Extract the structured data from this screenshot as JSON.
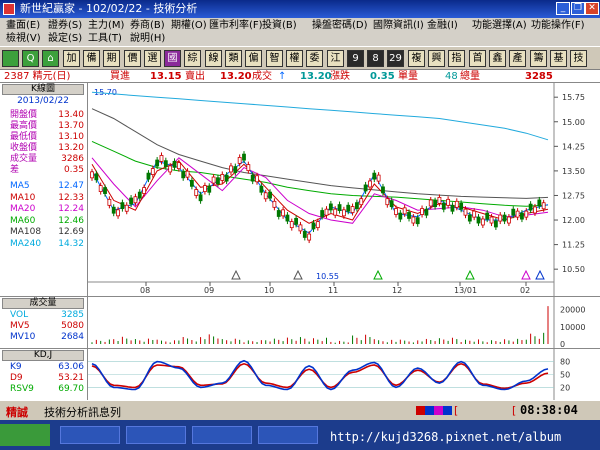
{
  "window": {
    "title": "新世紀贏家 - 102/02/22 - 技術分析",
    "minimize": "_",
    "restore": "❐",
    "close": "✕"
  },
  "menu": {
    "row1": [
      {
        "label": "畫面(E)"
      },
      {
        "label": "證券(S)"
      },
      {
        "label": "主力(M)"
      },
      {
        "label": "券商(B)"
      },
      {
        "label": "期權(O)"
      },
      {
        "label": "匯市利率(F)"
      },
      {
        "label": "投資(B)"
      },
      {
        "label": "操盤密碼(D)"
      },
      {
        "label": "國際資訊(I)"
      },
      {
        "label": "金融(I)"
      },
      {
        "label": "功能選擇(A)"
      },
      {
        "label": "功能操作(F)"
      }
    ],
    "row2": [
      {
        "label": "檢視(V)"
      },
      {
        "label": "設定(S)"
      },
      {
        "label": "工具(T)"
      },
      {
        "label": "說明(H)"
      }
    ]
  },
  "toolbar": {
    "buttons": [
      {
        "label": "Q",
        "icon": "search-icon",
        "style": "green"
      },
      {
        "label": "⌂",
        "icon": "home-icon",
        "style": "green"
      },
      {
        "label": "加",
        "style": "plain"
      },
      {
        "label": "備",
        "style": "plain"
      },
      {
        "label": "期",
        "style": "plain"
      },
      {
        "label": "價",
        "style": "plain"
      },
      {
        "label": "選",
        "style": "plain"
      },
      {
        "label": "國",
        "style": "purple"
      },
      {
        "label": "綜",
        "style": "plain"
      },
      {
        "label": "線",
        "style": "plain"
      },
      {
        "label": "類",
        "style": "plain"
      },
      {
        "label": "偏",
        "style": "plain"
      },
      {
        "label": "智",
        "style": "plain"
      },
      {
        "label": "權",
        "style": "plain"
      },
      {
        "label": "委",
        "style": "plain"
      },
      {
        "label": "江",
        "style": "plain"
      },
      {
        "label": "9",
        "style": "dark"
      },
      {
        "label": "8",
        "style": "dark"
      },
      {
        "label": "29",
        "style": "dark"
      },
      {
        "label": "複",
        "style": "plain"
      },
      {
        "label": "興",
        "style": "plain"
      },
      {
        "label": "指",
        "style": "plain"
      },
      {
        "label": "首",
        "style": "plain"
      },
      {
        "label": "鑫",
        "style": "plain"
      },
      {
        "label": "產",
        "style": "plain"
      },
      {
        "label": "籌",
        "style": "plain"
      },
      {
        "label": "基",
        "style": "plain"
      },
      {
        "label": "技",
        "style": "plain"
      }
    ]
  },
  "info": {
    "stock": "2387 精元(日)",
    "buy_label": "買進",
    "buy": "13.15",
    "sell_label": "賣出",
    "sell": "13.20",
    "trade_label": "成交",
    "trade": "13.20",
    "change_label": "漲跌",
    "change": "0.35",
    "vol_label": "單量",
    "total": "48",
    "total_label": "總量",
    "total_vol": "3285"
  },
  "quote": {
    "panel_title": "K線圖",
    "date": "2013/02/22",
    "rows": [
      {
        "label": "開盤價",
        "value": "13.40",
        "color": "#cc0000"
      },
      {
        "label": "最高價",
        "value": "13.70",
        "color": "#cc0000"
      },
      {
        "label": "最低價",
        "value": "13.10",
        "color": "#cc0000"
      },
      {
        "label": "收盤價",
        "value": "13.20",
        "color": "#cc0000"
      },
      {
        "label": "成交量",
        "value": "3286",
        "color": "#cc0000"
      },
      {
        "label": "差",
        "value": "0.35",
        "color": "#cc0000"
      }
    ],
    "ma": [
      {
        "label": "MA5",
        "value": "12.47",
        "color": "#0066ff"
      },
      {
        "label": "MA10",
        "value": "12.33",
        "color": "#cc0000"
      },
      {
        "label": "MA20",
        "value": "12.24",
        "color": "#cc00cc"
      },
      {
        "label": "MA60",
        "value": "12.46",
        "color": "#00aa00"
      },
      {
        "label": "MA108",
        "value": "12.69",
        "color": "#333333"
      },
      {
        "label": "MA240",
        "value": "14.32",
        "color": "#00aadd"
      }
    ]
  },
  "chart_data": {
    "type": "line",
    "title": "",
    "price_high_label": "15.70",
    "price_low_label": "10.55",
    "y_ticks": [
      "15.75",
      "15.00",
      "14.25",
      "13.50",
      "12.75",
      "12.00",
      "11.25",
      "10.50"
    ],
    "ylim": [
      10.2,
      16.0
    ],
    "x_ticks": [
      "08",
      "09",
      "10",
      "11",
      "12",
      "13/01",
      "02"
    ],
    "series": [
      {
        "name": "MA240",
        "color": "#22aadd",
        "values": [
          15.9,
          15.85,
          15.8,
          15.75,
          15.7,
          15.65,
          15.6,
          15.55,
          15.5,
          15.45,
          15.4,
          15.35,
          15.3,
          15.25,
          15.2,
          15.15,
          15.1,
          15.0,
          14.9,
          14.8,
          14.65,
          14.45
        ]
      },
      {
        "name": "MA108",
        "color": "#555555",
        "values": [
          15.4,
          15.1,
          14.7,
          14.3,
          14.0,
          13.8,
          13.6,
          13.45,
          13.35,
          13.25,
          13.15,
          13.05,
          12.98,
          12.92,
          12.86,
          12.8,
          12.76,
          12.72,
          12.7,
          12.68,
          12.66,
          12.69
        ]
      },
      {
        "name": "MA60",
        "color": "#00aa00",
        "values": [
          14.4,
          14.1,
          13.8,
          13.6,
          13.5,
          13.45,
          13.35,
          13.25,
          13.15,
          13.0,
          12.9,
          12.8,
          12.75,
          12.72,
          12.7,
          12.65,
          12.6,
          12.55,
          12.5,
          12.45,
          12.42,
          12.46
        ]
      },
      {
        "name": "MA20",
        "color": "#cc00cc",
        "values": [
          13.9,
          13.1,
          12.4,
          13.2,
          13.9,
          13.4,
          12.9,
          13.6,
          13.3,
          12.6,
          12.2,
          12.0,
          11.9,
          12.8,
          12.6,
          12.3,
          12.35,
          12.4,
          12.3,
          12.1,
          12.15,
          12.24
        ]
      },
      {
        "name": "MA10",
        "color": "#cc0000",
        "values": [
          13.7,
          12.6,
          12.3,
          13.5,
          13.8,
          13.0,
          13.1,
          13.7,
          13.0,
          12.3,
          11.9,
          12.2,
          12.0,
          13.1,
          12.4,
          12.2,
          12.5,
          12.4,
          12.2,
          12.0,
          12.2,
          12.33
        ]
      },
      {
        "name": "MA5",
        "color": "#0066ff",
        "values": [
          13.5,
          12.3,
          12.5,
          13.8,
          13.6,
          12.8,
          13.3,
          13.8,
          12.8,
          12.0,
          11.6,
          12.4,
          12.2,
          13.4,
          12.2,
          12.1,
          12.6,
          12.3,
          12.0,
          12.0,
          12.3,
          12.47
        ]
      }
    ],
    "volume": {
      "label": "成交量",
      "rows": [
        {
          "label": "VOL",
          "value": "3285",
          "color": "#00aadd"
        },
        {
          "label": "MV5",
          "value": "5080",
          "color": "#cc0000"
        },
        {
          "label": "MV10",
          "value": "2684",
          "color": "#0033cc"
        }
      ],
      "y_ticks": [
        "20000",
        "10000",
        "0"
      ],
      "ylim": [
        0,
        25000
      ],
      "values": [
        2000,
        3500,
        2600,
        1800,
        2900,
        4000,
        2200,
        1600,
        2400,
        3100,
        2800,
        1500,
        4500,
        2000,
        1800,
        2100,
        2600,
        1900,
        1700,
        2300,
        5000,
        22000
      ]
    },
    "kd": {
      "label": "KD,J",
      "rows": [
        {
          "label": "K9",
          "value": "63.06",
          "color": "#0033cc"
        },
        {
          "label": "D9",
          "value": "53.21",
          "color": "#cc0000"
        },
        {
          "label": "RSV9",
          "value": "69.70",
          "color": "#00aa00"
        }
      ],
      "y_ticks": [
        "80",
        "50",
        "20"
      ],
      "ylim": [
        0,
        100
      ],
      "k": [
        75,
        20,
        15,
        80,
        65,
        20,
        30,
        82,
        25,
        15,
        70,
        15,
        60,
        78,
        20,
        65,
        30,
        80,
        25,
        15,
        35,
        63
      ],
      "d": [
        70,
        25,
        20,
        72,
        68,
        25,
        28,
        75,
        30,
        20,
        62,
        20,
        55,
        72,
        25,
        60,
        32,
        75,
        28,
        18,
        30,
        53
      ]
    }
  },
  "status": {
    "label1": "精誠",
    "label2": "技術分析訊息列",
    "clock": "08:38:04"
  },
  "taskbar": {
    "url": "http://kujd3268.pixnet.net/album"
  }
}
